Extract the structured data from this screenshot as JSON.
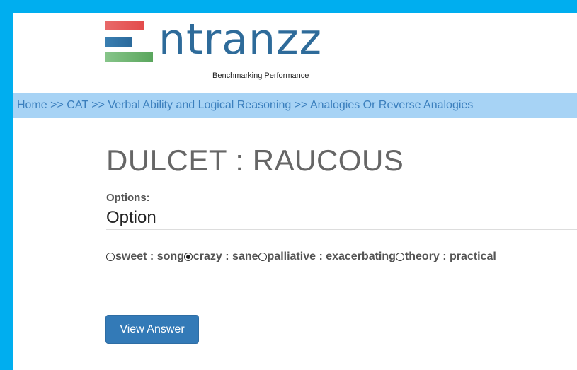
{
  "logo": {
    "wordmark": "ntranzz",
    "tagline": "Benchmarking Performance"
  },
  "breadcrumb": {
    "items": [
      "Home",
      "CAT",
      "Verbal Ability and Logical Reasoning",
      "Analogies Or Reverse Analogies"
    ],
    "separator": ">>"
  },
  "question": {
    "text": "DULCET : RAUCOUS"
  },
  "options_section": {
    "label": "Options:",
    "heading": "Option",
    "choices": [
      {
        "label": "sweet : song",
        "selected": false
      },
      {
        "label": "crazy : sane",
        "selected": true
      },
      {
        "label": "palliative : exacerbating",
        "selected": false
      },
      {
        "label": "theory : practical",
        "selected": false
      }
    ]
  },
  "actions": {
    "view_answer": "View Answer"
  },
  "colors": {
    "frame": "#00aeef",
    "breadcrumb_bg": "#a7d3f5",
    "link": "#3b7fbd",
    "button": "#337ab7",
    "logo_text": "#2e6b9a"
  }
}
